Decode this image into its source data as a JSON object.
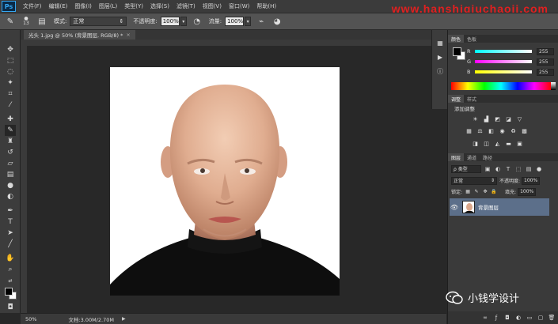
{
  "app": {
    "logo": "Ps",
    "menu": [
      "文件(F)",
      "编辑(E)",
      "图像(I)",
      "图层(L)",
      "类型(Y)",
      "选择(S)",
      "滤镜(T)",
      "视图(V)",
      "窗口(W)",
      "帮助(H)"
    ],
    "watermark": "www.hanshiqiuchaoji.com"
  },
  "options_bar": {
    "brush_size": "13",
    "mode_label": "模式:",
    "mode_value": "正常",
    "opacity_label": "不透明度:",
    "opacity_value": "100%",
    "flow_label": "流量:",
    "flow_value": "100%"
  },
  "document": {
    "tab_title": "光头 1.jpg @ 50% (背景图层, RGB/8) *",
    "tab_close": "×"
  },
  "status_bar": {
    "zoom": "50%",
    "doc_size": "文档:3.00M/2.70M",
    "arrow": "▶"
  },
  "color_panel": {
    "tabs": [
      "颜色",
      "色板"
    ],
    "channels": [
      {
        "label": "R",
        "value": "255"
      },
      {
        "label": "G",
        "value": "255"
      },
      {
        "label": "B",
        "value": "255"
      }
    ]
  },
  "adjustments_panel": {
    "tabs": [
      "调整",
      "样式"
    ],
    "title": "添加调整"
  },
  "layers_panel": {
    "tabs": [
      "图层",
      "通道",
      "路径"
    ],
    "filter_type": "ρ 类型",
    "blend_mode": "正常",
    "opacity_label": "不透明度:",
    "opacity_value": "100%",
    "lock_label": "锁定:",
    "fill_label": "填充:",
    "fill_value": "100%",
    "layers": [
      {
        "name": "背景图层",
        "visible": true
      }
    ]
  },
  "overlay": {
    "wechat_name": "小钱学设计"
  },
  "colors": {
    "foreground": "#000000",
    "background": "#ffffff",
    "selected_layer": "#5c6f8a",
    "watermark_red": "#e02020"
  }
}
